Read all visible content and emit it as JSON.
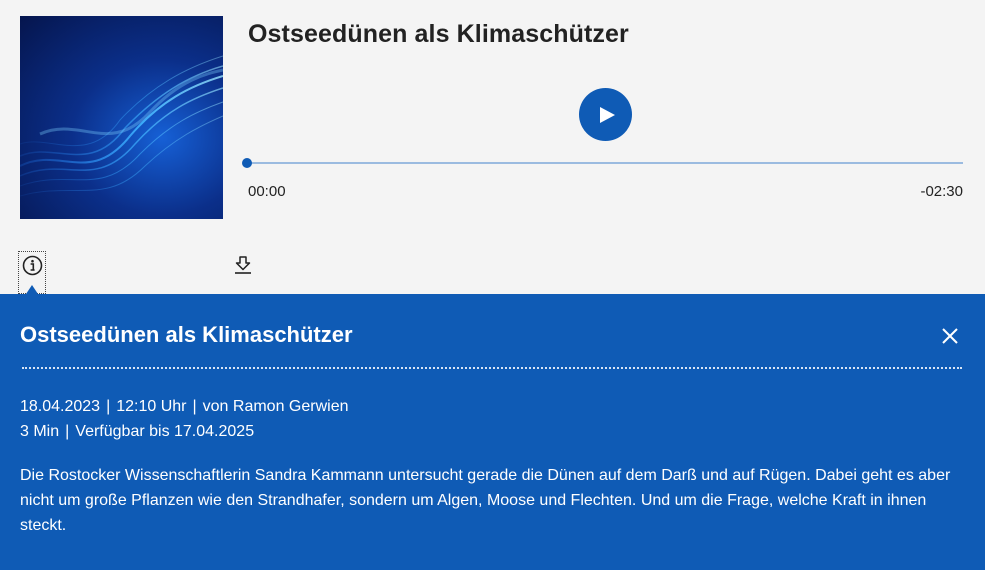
{
  "player": {
    "title": "Ostseedünen als Klimaschützer",
    "time_elapsed": "00:00",
    "time_remaining": "-02:30",
    "progress": 0
  },
  "icons": {
    "play": "play-icon",
    "info": "info-icon",
    "download": "download-icon",
    "close": "close-icon"
  },
  "panel": {
    "title": "Ostseedünen als Klimaschützer",
    "date": "18.04.2023",
    "time": "12:10 Uhr",
    "author": "von Ramon Gerwien",
    "duration": "3 Min",
    "availability": "Verfügbar bis 17.04.2025",
    "description": "Die Rostocker Wissenschaftlerin Sandra Kammann untersucht gerade die Dünen auf dem Darß und auf Rügen. Dabei geht es aber nicht um große Pflanzen wie den Strandhafer, sondern um Algen, Moose und Flechten. Und um die Frage, welche Kraft in ihnen steckt.",
    "separator": "|"
  },
  "colors": {
    "accent": "#0f5bb5",
    "background": "#f4f4f4",
    "progress_track": "#9bbbe0"
  }
}
